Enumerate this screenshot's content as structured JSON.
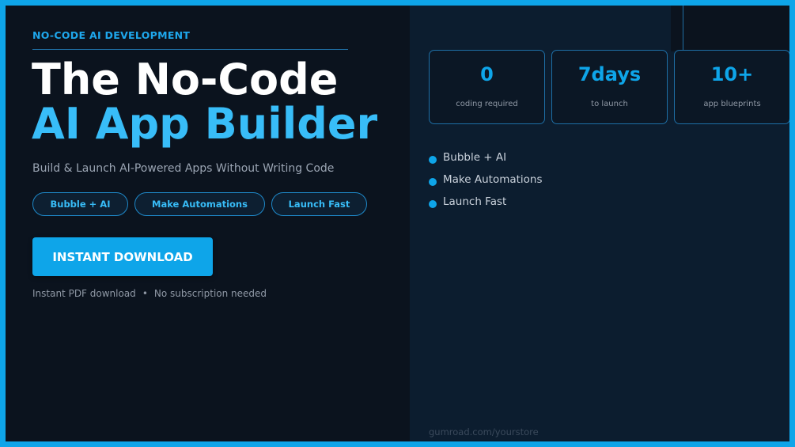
{
  "hero": {
    "eyebrow": "NO-CODE AI DEVELOPMENT",
    "title_line1": "The No-Code",
    "title_line2": "AI App Builder",
    "subtitle": "Build & Launch AI-Powered Apps Without Writing Code"
  },
  "pills": [
    "Bubble + AI",
    "Make Automations",
    "Launch Fast"
  ],
  "cta": {
    "label": "INSTANT DOWNLOAD"
  },
  "note": {
    "left": "Instant PDF download",
    "separator": "•",
    "right": "No subscription needed"
  },
  "stats": [
    {
      "value": "0",
      "label": "coding required"
    },
    {
      "value": "7days",
      "label": "to launch"
    },
    {
      "value": "10+",
      "label": "app blueprints"
    }
  ],
  "features": [
    "Bubble + AI",
    "Make Automations",
    "Launch Fast"
  ],
  "footer": {
    "url": "gumroad.com/yourstore"
  },
  "colors": {
    "accent": "#0ea5e9",
    "accent_light": "#38bdf8",
    "background": "#0b131e",
    "panel": "#0c1d2f"
  },
  "icons": {
    "feature_bullet": "bullet-dot-icon"
  }
}
